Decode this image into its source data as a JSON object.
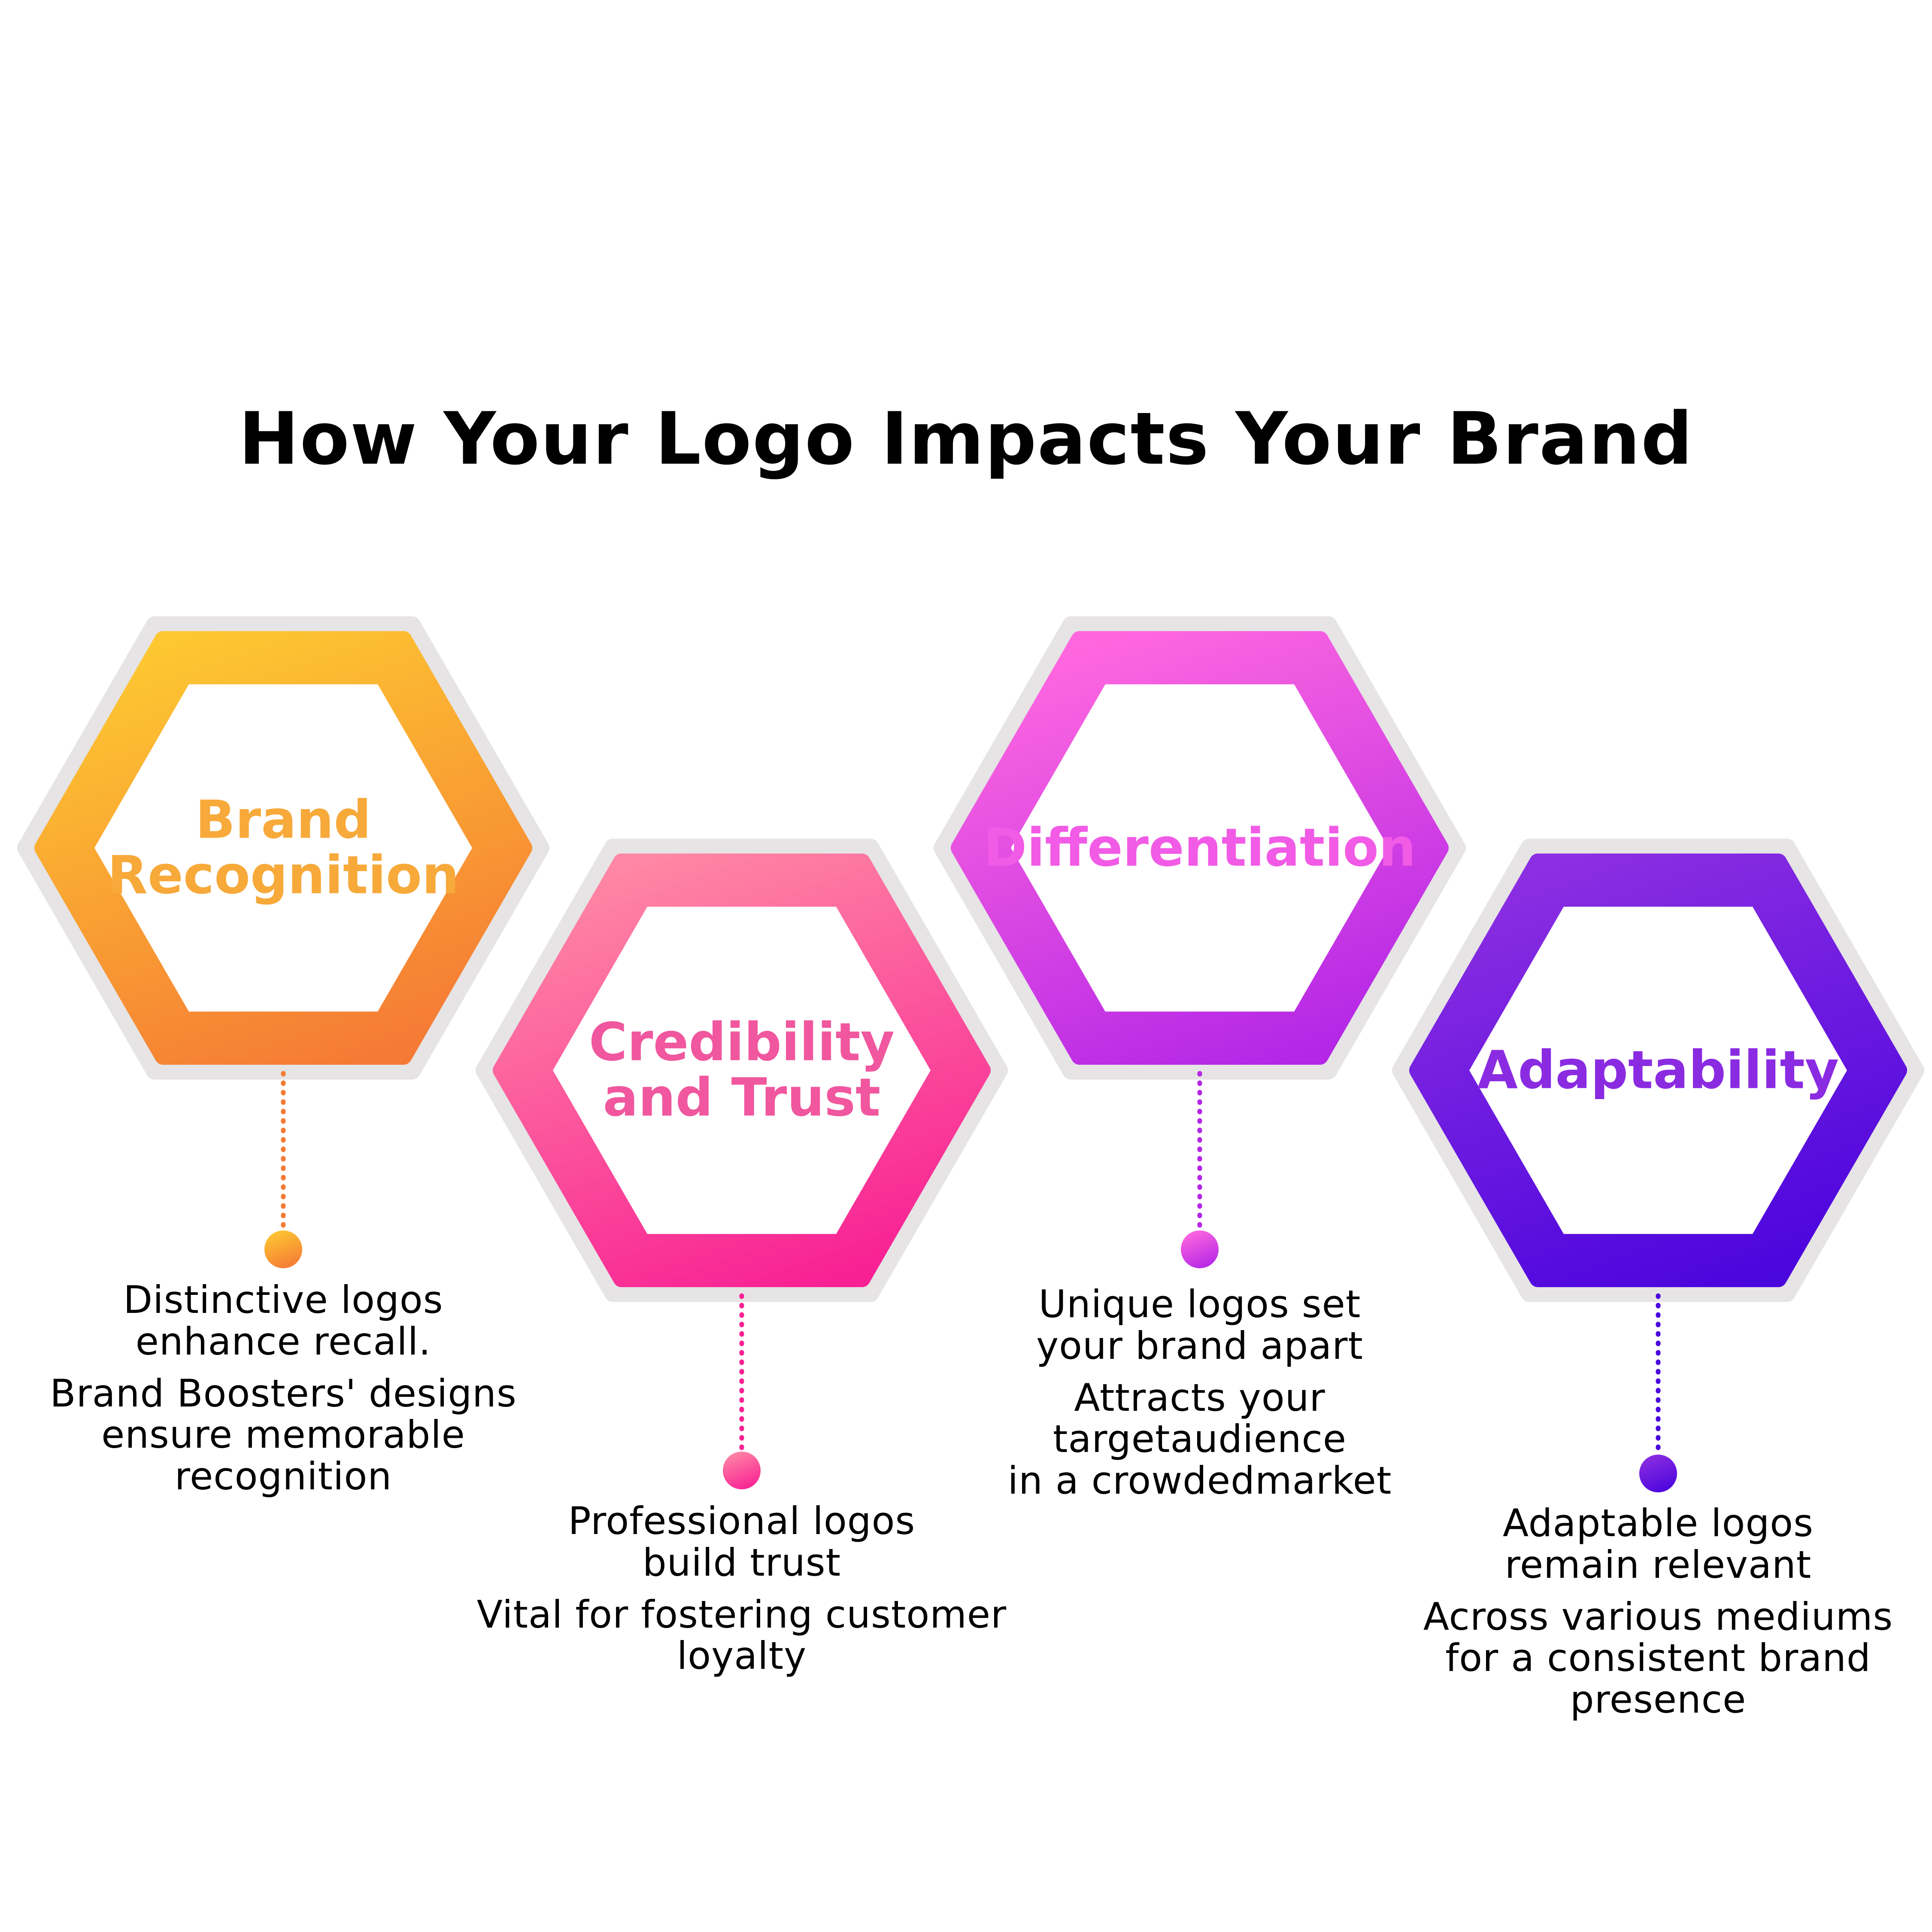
{
  "title": "How Your Logo Impacts Your Brand",
  "items": [
    {
      "heading_lines": [
        "Brand",
        "Recognition"
      ],
      "color": "#F7A93A",
      "gradient": [
        "#FDC731",
        "#F57A35"
      ],
      "desc_paragraphs": [
        [
          "Distinctive logos",
          "enhance recall."
        ],
        [
          "Brand Boosters' designs",
          "ensure memorable",
          "recognition"
        ]
      ]
    },
    {
      "heading_lines": [
        "Credibility",
        "and Trust"
      ],
      "color": "#F0579E",
      "gradient": [
        "#FF86A4",
        "#F82194"
      ],
      "desc_paragraphs": [
        [
          "Professional logos",
          "build trust"
        ],
        [
          "Vital for fostering customer",
          "loyalty"
        ]
      ]
    },
    {
      "heading_lines": [
        "Differentiation"
      ],
      "color": "#F15BE6",
      "gradient": [
        "#FF67DF",
        "#B427E6"
      ],
      "desc_paragraphs": [
        [
          "Unique logos set",
          "your brand apart"
        ],
        [
          "Attracts your",
          "targetaudience",
          "in a crowdedmarket"
        ]
      ]
    },
    {
      "heading_lines": [
        "Adaptability"
      ],
      "color": "#8A2BE2",
      "gradient": [
        "#8C2EE2",
        "#4B05DD"
      ],
      "desc_paragraphs": [
        [
          "Adaptable logos",
          "remain relevant"
        ],
        [
          "Across various mediums",
          "for a consistent brand",
          "presence"
        ]
      ]
    }
  ]
}
